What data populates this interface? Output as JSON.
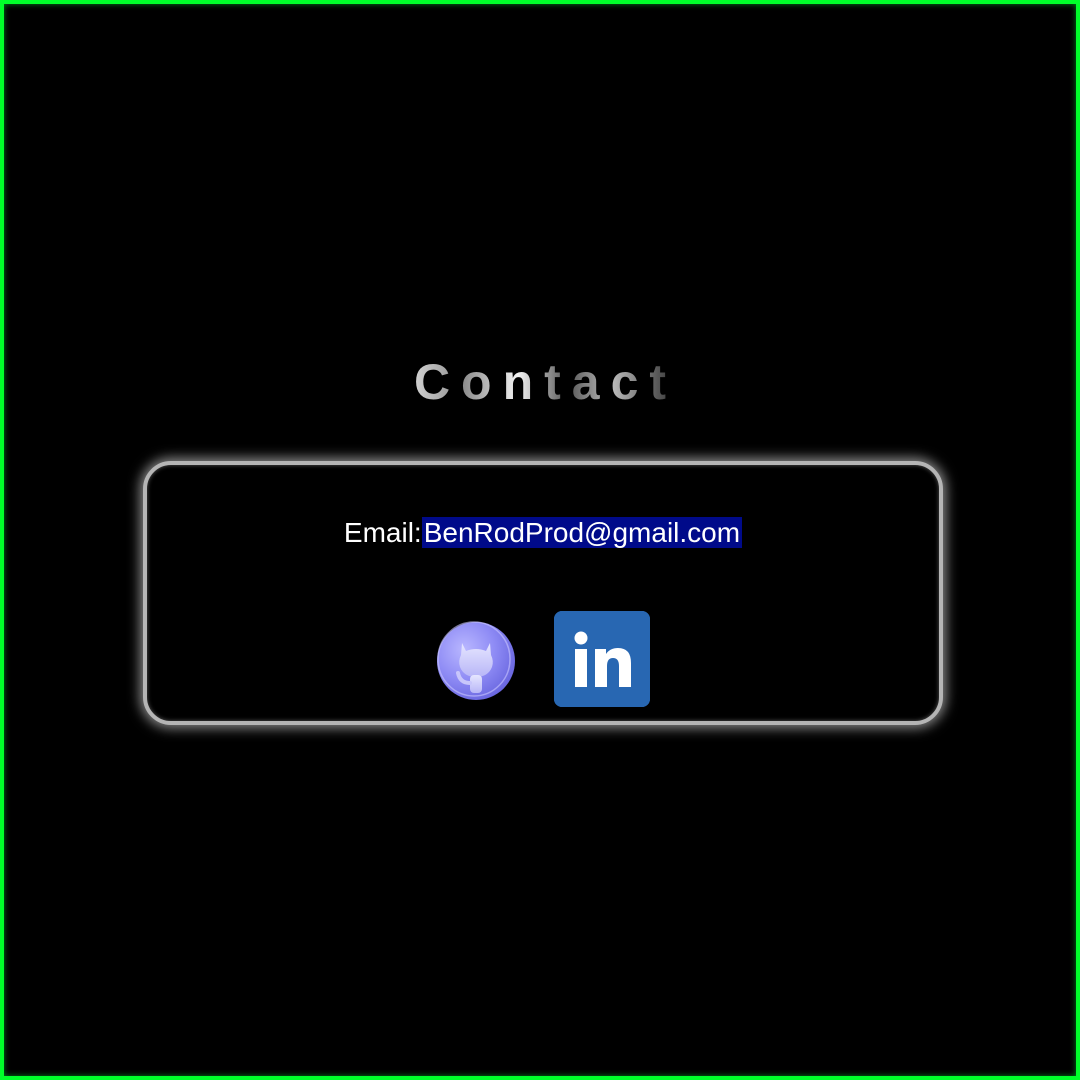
{
  "page": {
    "title": "Contact"
  },
  "contact": {
    "email_label": "Email:",
    "email_value": "BenRodProd@gmail.com"
  },
  "social": [
    {
      "name": "github-icon",
      "label": "GitHub"
    },
    {
      "name": "linkedin-icon",
      "label": "in"
    }
  ],
  "colors": {
    "frame": "#00ff2a",
    "background": "#000000",
    "card_border": "#b5b5b5",
    "email_highlight": "#000a8a",
    "github_purple": "#8f8cf5",
    "linkedin_blue": "#2867b2"
  }
}
